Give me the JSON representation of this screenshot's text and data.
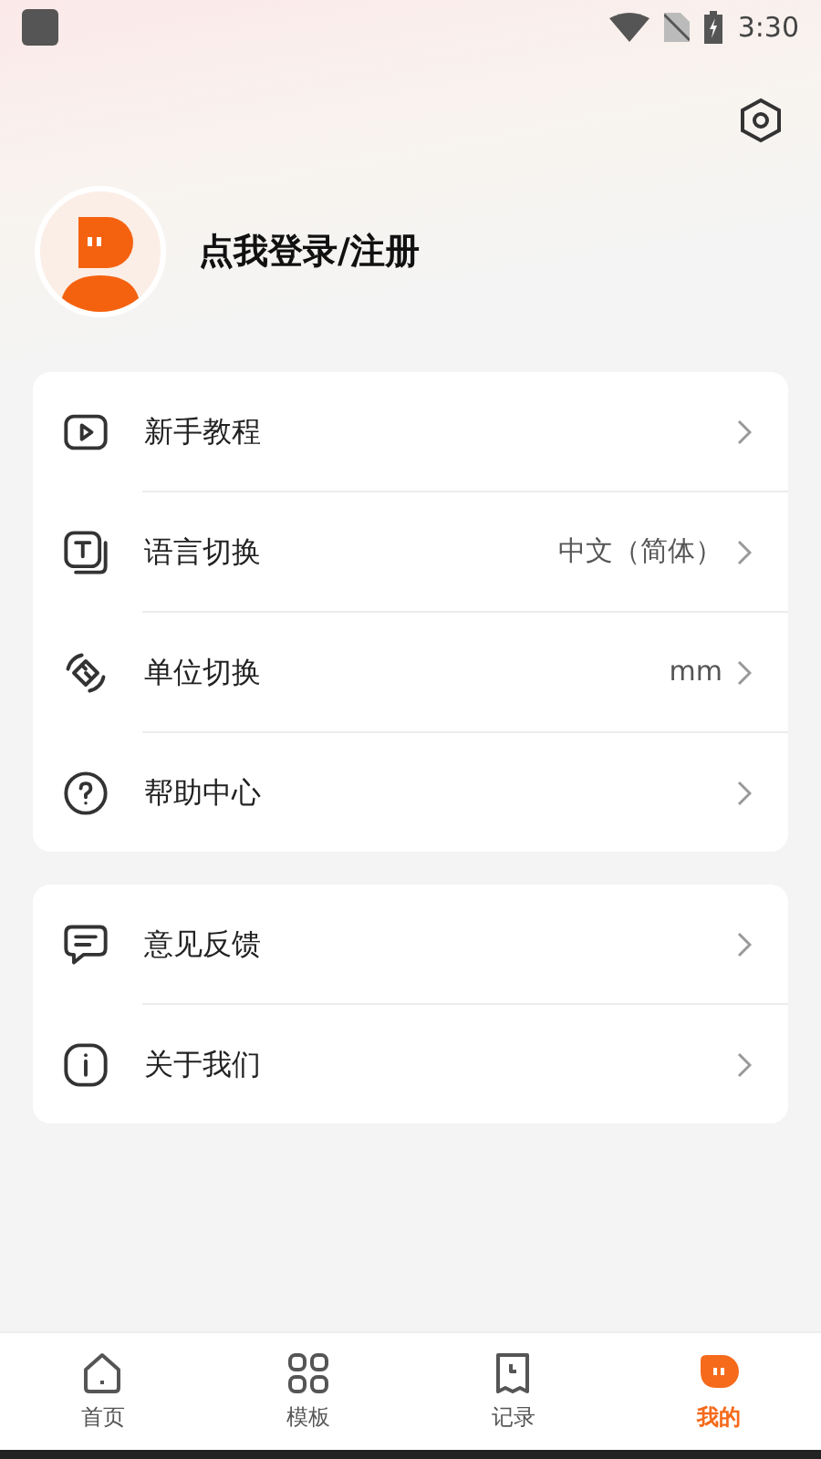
{
  "status_bar": {
    "time": "3:30"
  },
  "profile": {
    "login_text": "点我登录/注册"
  },
  "menu_groups": [
    {
      "items": [
        {
          "kind": "video",
          "label": "新手教程"
        },
        {
          "kind": "text",
          "label": "语言切换",
          "value": "中文（简体）"
        },
        {
          "kind": "ruler",
          "label": "单位切换",
          "value": "mm"
        },
        {
          "kind": "help",
          "label": "帮助中心"
        }
      ]
    },
    {
      "items": [
        {
          "kind": "feedback",
          "label": "意见反馈"
        },
        {
          "kind": "info",
          "label": "关于我们"
        }
      ]
    }
  ],
  "tabs": [
    {
      "kind": "home",
      "label": "首页",
      "selected": false
    },
    {
      "kind": "grid",
      "label": "模板",
      "selected": false
    },
    {
      "kind": "record",
      "label": "记录",
      "selected": false
    },
    {
      "kind": "mine",
      "label": "我的",
      "selected": true
    }
  ]
}
